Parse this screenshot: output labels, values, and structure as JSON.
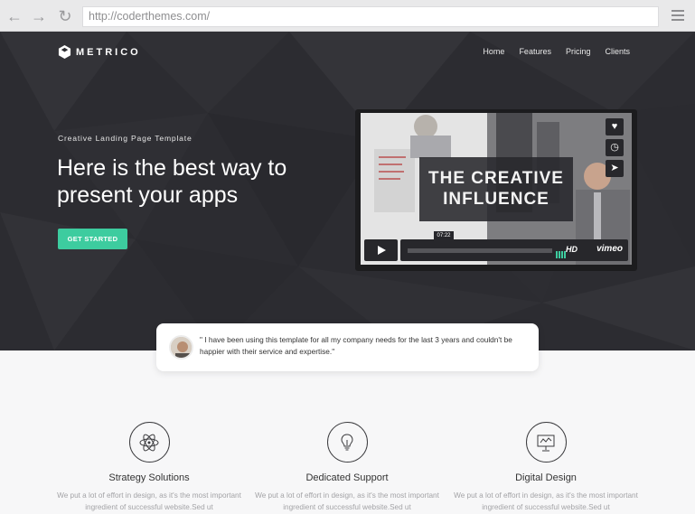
{
  "browser": {
    "url": "http://coderthemes.com/",
    "back_icon": "arrow-left-icon",
    "forward_icon": "arrow-right-icon",
    "reload_icon": "reload-icon",
    "menu_icon": "hamburger-menu-icon"
  },
  "header": {
    "brand": "METRICO",
    "nav": [
      "Home",
      "Features",
      "Pricing",
      "Clients"
    ]
  },
  "hero": {
    "tagline": "Creative Landing Page Template",
    "headline_line1": "Here is the best way to",
    "headline_line2": "present your apps",
    "cta_label": "GET STARTED",
    "accent_color": "#3dcc9f",
    "background_color": "#2c2c31"
  },
  "video": {
    "title_line1": "THE CREATIVE",
    "title_line2": "INFLUENCE",
    "time": "07:22",
    "hd_label": "HD",
    "brand": "vimeo",
    "side_icons": [
      "heart-icon",
      "clock-icon",
      "send-icon"
    ]
  },
  "testimonial": {
    "quote": "\" I have been using this template for all my company needs for the last 3 years and couldn't be happier with their service and expertise.\""
  },
  "features": [
    {
      "title": "Strategy Solutions",
      "text": "We put a lot of effort in design, as it's the most important ingredient of successful website.Sed ut",
      "icon": "atom-icon"
    },
    {
      "title": "Dedicated Support",
      "text": "We put a lot of effort in design, as it's the most important ingredient of successful website.Sed ut",
      "icon": "lightbulb-icon"
    },
    {
      "title": "Digital Design",
      "text": "We put a lot of effort in design, as it's the most important ingredient of successful website.Sed ut",
      "icon": "presentation-icon"
    }
  ]
}
